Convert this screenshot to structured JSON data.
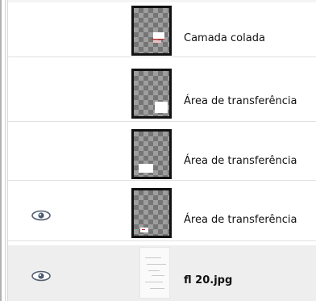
{
  "layers": [
    {
      "name": "Camada colada",
      "visible": false,
      "selected": false,
      "thumb_type": "transparent"
    },
    {
      "name": "Área de transferência",
      "visible": false,
      "selected": false,
      "thumb_type": "transparent"
    },
    {
      "name": "Área de transferência",
      "visible": false,
      "selected": false,
      "thumb_type": "transparent"
    },
    {
      "name": "Área de transferência",
      "visible": true,
      "selected": false,
      "thumb_type": "transparent"
    },
    {
      "name": "fl 20.jpg",
      "visible": true,
      "selected": true,
      "thumb_type": "image"
    }
  ],
  "icons": {
    "visibility": "eye-icon"
  },
  "colors": {
    "selected_row": "#eeeeee",
    "thumb_border": "#111111",
    "paste_marker": "#d02020"
  }
}
